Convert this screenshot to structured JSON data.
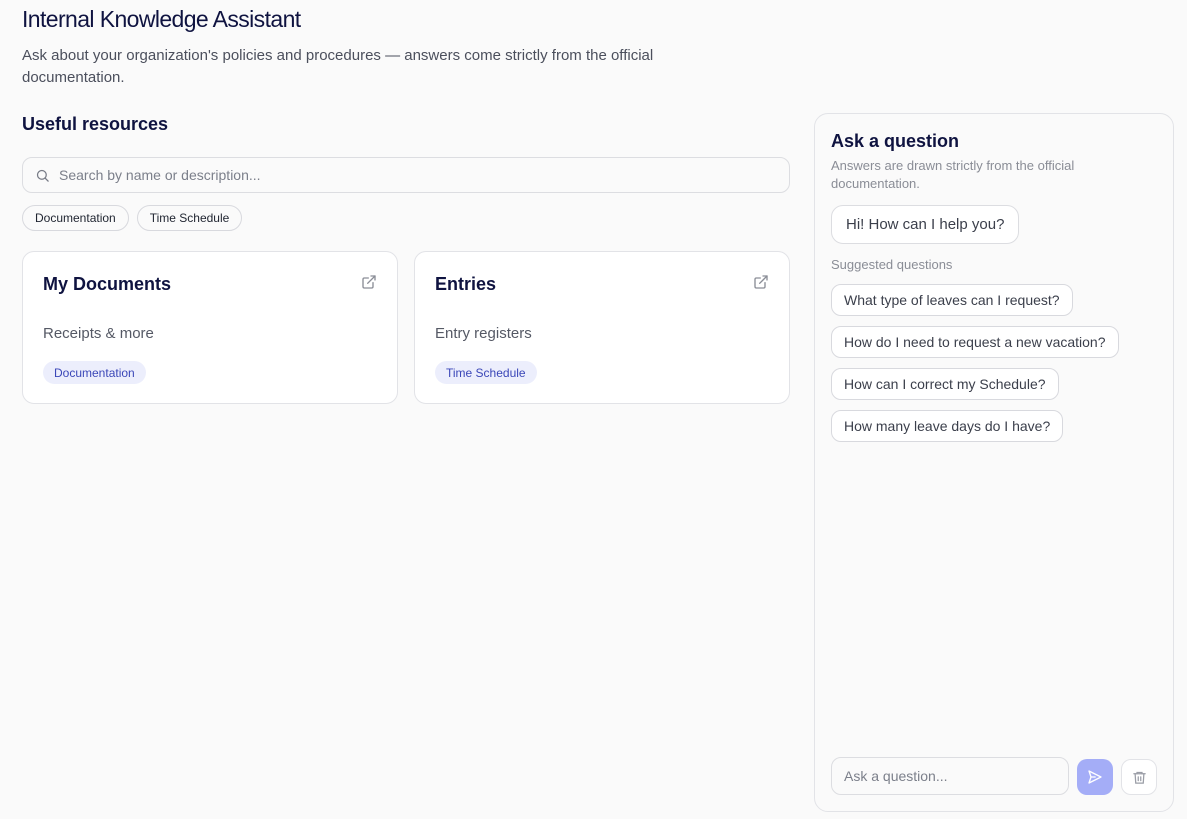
{
  "header": {
    "title": "Internal Knowledge Assistant",
    "subtitle": "Ask about your organization's policies and procedures — answers come strictly from the official documentation."
  },
  "resources": {
    "title": "Useful resources",
    "search_placeholder": "Search by name or description...",
    "filters": [
      "Documentation",
      "Time Schedule"
    ],
    "cards": [
      {
        "title": "My Documents",
        "description": "Receipts & more",
        "tag": "Documentation"
      },
      {
        "title": "Entries",
        "description": "Entry registers",
        "tag": "Time Schedule"
      }
    ]
  },
  "chat": {
    "title": "Ask a question",
    "subtitle": "Answers are drawn strictly from the official documentation.",
    "greeting": "Hi! How can I help you?",
    "suggested_label": "Suggested questions",
    "suggestions": [
      "What type of leaves can I request?",
      "How do I need to request a new vacation?",
      "How can I correct my Schedule?",
      "How many leave days do I have?"
    ],
    "input_placeholder": "Ask a question..."
  },
  "colors": {
    "accent": "#a4adf7",
    "tag_bg": "#eceefc",
    "tag_text": "#3b47b8",
    "title": "#0f1340"
  },
  "icons": [
    "search-icon",
    "external-link-icon",
    "send-icon",
    "trash-icon"
  ]
}
